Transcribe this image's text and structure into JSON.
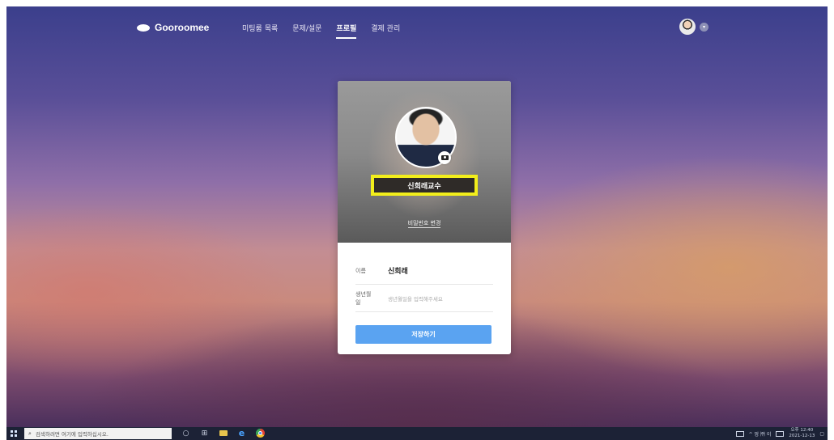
{
  "nav": {
    "logo_text": "Gooroomee",
    "menu": [
      {
        "label": "미팅룸 목록",
        "active": false
      },
      {
        "label": "문제/설문",
        "active": false
      },
      {
        "label": "프로필",
        "active": true
      },
      {
        "label": "결제 관리",
        "active": false
      }
    ]
  },
  "profile": {
    "nickname": "신희래교수",
    "password_link": "비밀번호 변경",
    "fields": {
      "name_label": "이름",
      "name_value": "신희래",
      "birthday_label": "생년월일",
      "birthday_placeholder": "생년월일을 입력해주세요"
    },
    "save_button": "저장하기",
    "highlight_color": "#f2ee1b",
    "button_color": "#5aa3f1"
  },
  "taskbar": {
    "search_placeholder": "검색하려면 여기에 입력하십시오.",
    "tray_text": "^ 멍 ㈜ 이 ",
    "clock_ampm": "오후 12:40",
    "clock_date": "2021-12-13"
  }
}
